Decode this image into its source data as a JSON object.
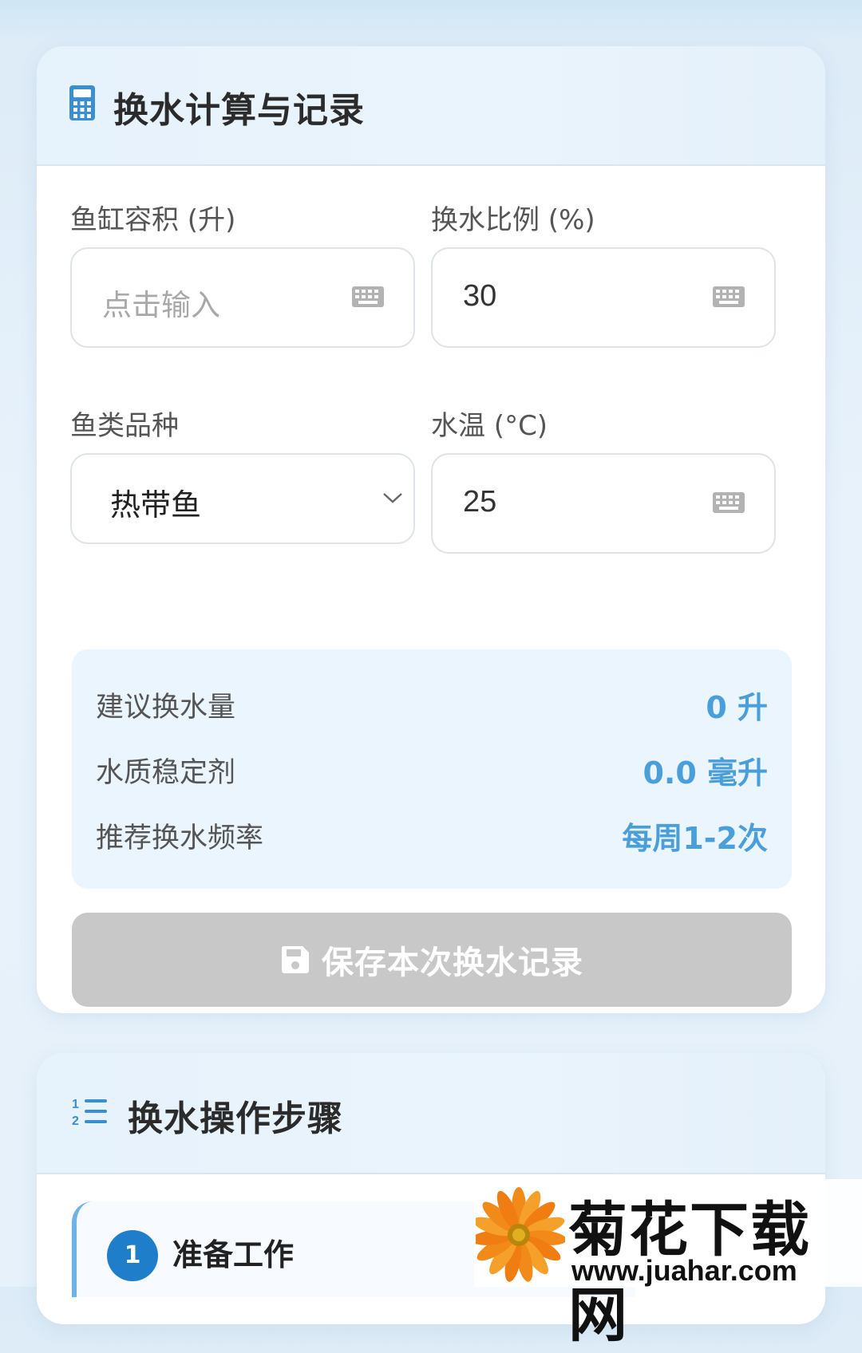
{
  "calc_card": {
    "title": "换水计算与记录",
    "icon": "calculator-icon",
    "fields": {
      "tank_volume": {
        "label": "鱼缸容积 (升)",
        "placeholder": "点击输入",
        "value": ""
      },
      "change_ratio": {
        "label": "换水比例 (%)",
        "value": "30"
      },
      "fish_type": {
        "label": "鱼类品种",
        "selected": "热带鱼"
      },
      "water_temp": {
        "label": "水温 (°C)",
        "value": "25"
      }
    },
    "results": [
      {
        "label": "建议换水量",
        "value": "0 升"
      },
      {
        "label": "水质稳定剂",
        "value": "0.0 毫升"
      },
      {
        "label": "推荐换水频率",
        "value": "每周1-2次"
      }
    ],
    "save_button": {
      "label": "保存本次换水记录",
      "icon": "floppy-disk-icon"
    }
  },
  "steps_card": {
    "title": "换水操作步骤",
    "icon": "numbered-list-icon",
    "steps": [
      {
        "number": "1",
        "title": "准备工作"
      }
    ]
  },
  "watermark": {
    "brand": "菊花下载网",
    "url": "www.juahar.com"
  },
  "colors": {
    "accent": "#4a9fda",
    "icon_blue": "#3a8fd0",
    "button_disabled": "#c8c8c8",
    "result_bg": "#eaf5fe"
  }
}
